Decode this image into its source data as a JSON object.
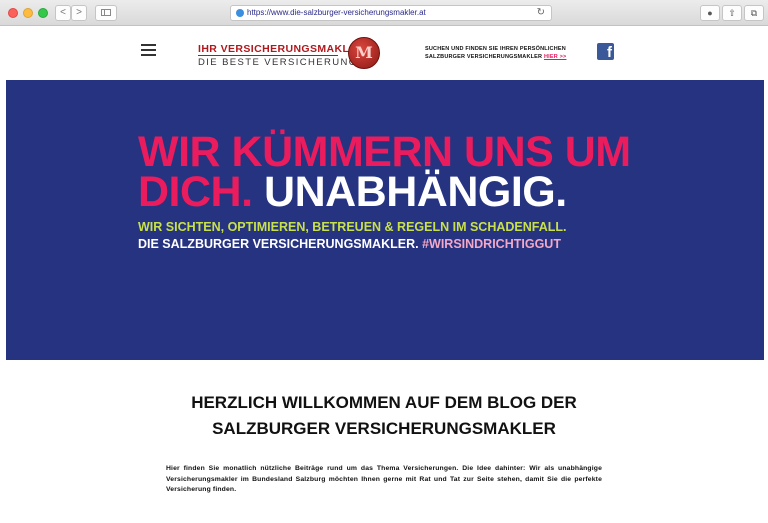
{
  "browser": {
    "url": "https://www.die-salzburger-versicherungsmakler.at",
    "back_glyph": "<",
    "forward_glyph": ">",
    "reload_glyph": "↻",
    "toolbar_icons": [
      "download-icon",
      "share-icon",
      "tabs-icon"
    ],
    "toolbar_glyphs": [
      "●",
      "⇧",
      "⧉"
    ]
  },
  "header": {
    "logo_line1": "IHR VERSICHERUNGSMAKLER",
    "logo_line2": "DIE BESTE VERSICHERUNG",
    "logo_seal_letter": "M",
    "tagline_line1": "SUCHEN UND FINDEN SIE IHREN PERSÖNLICHEN",
    "tagline_line2": "SALZBURGER VERSICHERUNGSMAKLER",
    "tagline_link": "HIER >>",
    "facebook_glyph": "f"
  },
  "hero": {
    "line1": "WIR KÜMMERN UNS UM",
    "line2_pink": "DICH.",
    "line2_white": "UNABHÄNGIG.",
    "sub1": "WIR SICHTEN, OPTIMIEREN, BETREUEN & REGELN IM SCHADENFALL.",
    "sub2_text": "DIE SALZBURGER VERSICHERUNGSMAKLER.",
    "sub2_hashtag": "#WIRSINDRICHTIGGUT"
  },
  "welcome": {
    "title_line1": "HERZLICH WILLKOMMEN AUF DEM BLOG DER",
    "title_line2": "SALZBURGER VERSICHERUNGSMAKLER",
    "body": "Hier finden Sie monatlich nützliche Beiträge rund um das Thema Versicherungen. Die Idee dahinter: Wir als unabhängige Versicherungsmakler im Bundesland Salzburg möchten Ihnen gerne mit Rat und Tat zur Seite stehen, damit Sie die perfekte Versicherung finden."
  },
  "colors": {
    "hero_bg": "#263381",
    "accent_pink": "#ea1c5d",
    "accent_lime": "#c8e04a",
    "hashtag_pink": "#f3a8c6",
    "logo_red": "#b0181d",
    "facebook_blue": "#3b5998"
  }
}
